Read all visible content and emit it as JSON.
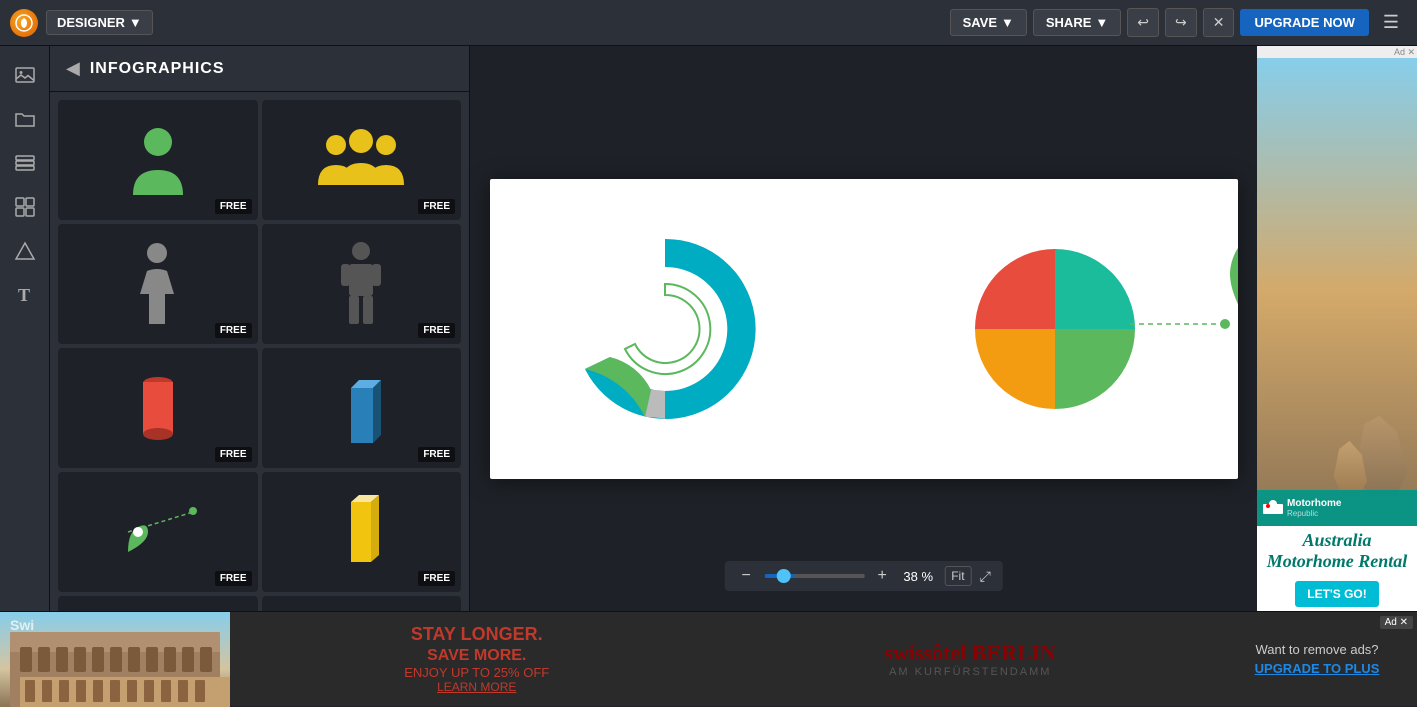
{
  "topbar": {
    "app_name": "DESIGNER",
    "save_label": "SAVE",
    "share_label": "SHARE",
    "upgrade_label": "UPGRADE NOW",
    "dropdown_arrow": "▼"
  },
  "sidebar": {
    "back_icon": "◀",
    "title": "INFOGRAPHICS",
    "free_badge": "FREE"
  },
  "canvas": {
    "zoom_pct": "38 %",
    "fit_label": "Fit"
  },
  "bottom_ad": {
    "headline": "STAY LONGER.",
    "sub": "SAVE MORE.",
    "off": "ENJOY UP TO 25% OFF",
    "link": "LEARN MORE",
    "brand": "swissôtel BERLIN",
    "city": "AM KURFÜRSTENDAMM",
    "remove_ads_text": "Want to remove ads?",
    "upgrade_to_plus": "UPGRADE TO PLUS",
    "ad_label": "Ad"
  },
  "ad_sidebar": {
    "ad_label": "Ad",
    "brand": "Motorhome Republic",
    "title": "Australia Motorhome Rental",
    "cta": "LET'S GO!"
  },
  "icons": {
    "image": "🖼",
    "folder": "📁",
    "layers": "▤",
    "grid": "⊞",
    "shapes": "△",
    "text": "T"
  }
}
